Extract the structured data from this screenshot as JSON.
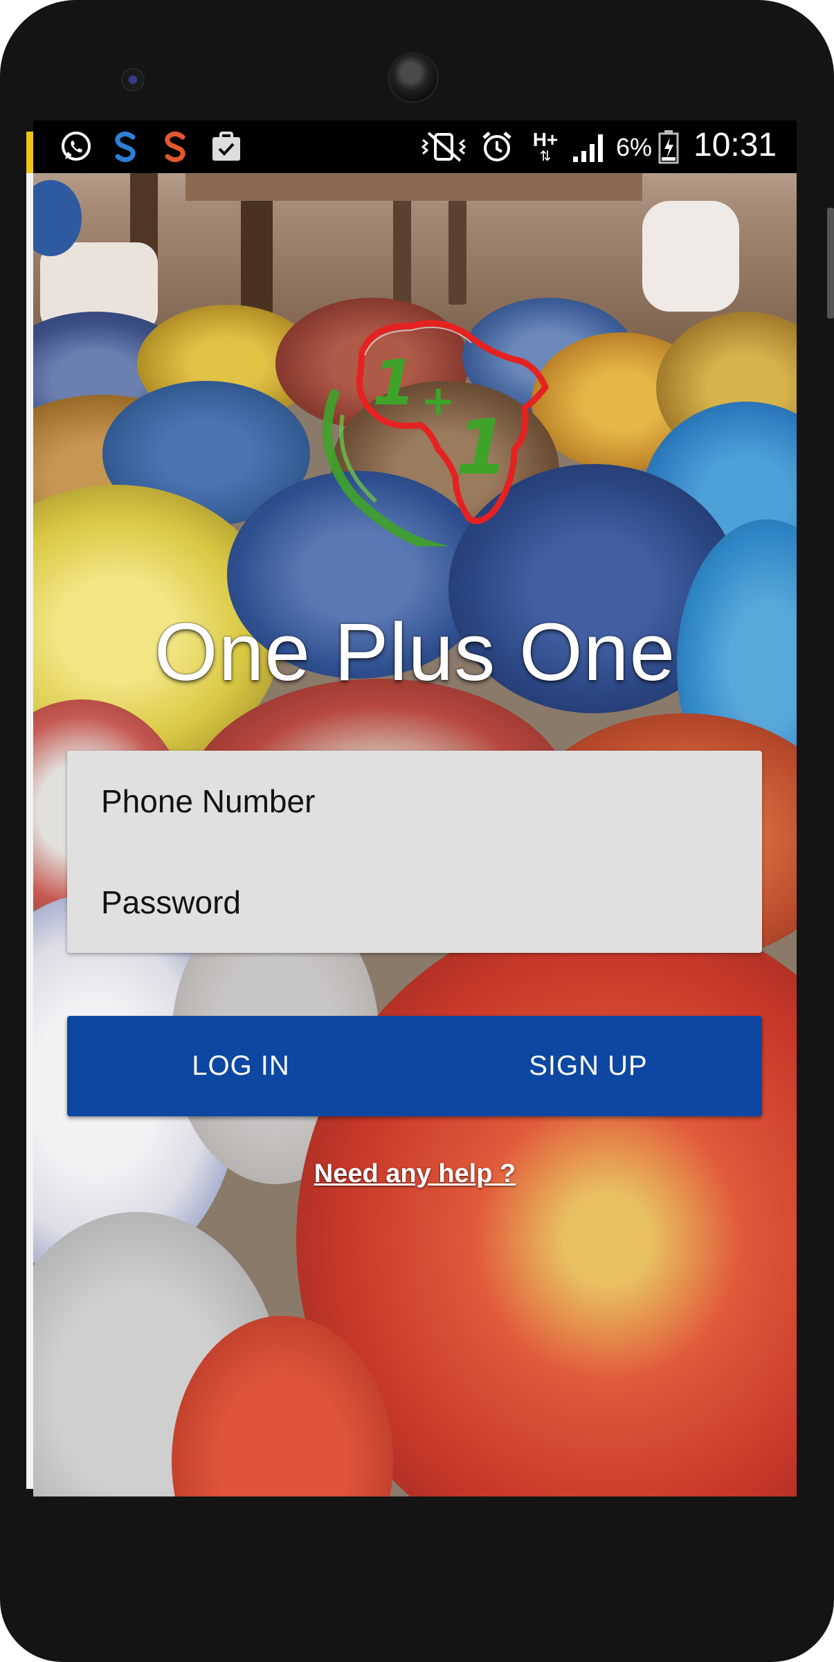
{
  "status_bar": {
    "notification_icons": [
      "whatsapp-icon",
      "skype-blue-icon",
      "skype-orange-icon",
      "clipboard-check-icon"
    ],
    "system_icons": [
      "vibrate-icon",
      "alarm-icon",
      "network-hplus-icon",
      "signal-icon",
      "battery-icon"
    ],
    "network_label": "H+",
    "battery_percent": "6%",
    "time": "10:31"
  },
  "app": {
    "title": "One Plus One",
    "logo": {
      "name": "africa-1plus1-logo",
      "text_top": "1",
      "text_plus": "+",
      "text_bottom": "1",
      "outline_color": "#e52222",
      "figure_color": "#3fa32a"
    }
  },
  "login_form": {
    "phone_placeholder": "Phone Number",
    "password_placeholder": "Password"
  },
  "actions": {
    "login_label": "LOG IN",
    "signup_label": "SIGN UP",
    "button_color": "#0d47a1"
  },
  "help": {
    "link_label": "Need any help ?"
  }
}
